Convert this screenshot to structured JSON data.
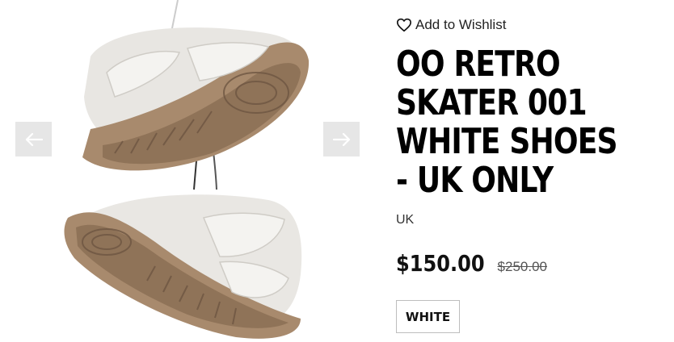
{
  "wishlist": {
    "label": "Add to Wishlist",
    "icon": "heart-outline-icon"
  },
  "product": {
    "title": "OO RETRO\nSKATER 001\nWHITE SHOES\n- UK ONLY",
    "region": "UK",
    "price": "$150.00",
    "compare_price": "$250.00",
    "variant": "WHITE"
  },
  "gallery": {
    "prev_icon": "arrow-left-icon",
    "next_icon": "arrow-right-icon",
    "image_alt": "white sneakers hanging by laces"
  },
  "colors": {
    "arrow_bg": "#e6e6e6",
    "text": "#111111",
    "border": "#bdbdbd"
  }
}
